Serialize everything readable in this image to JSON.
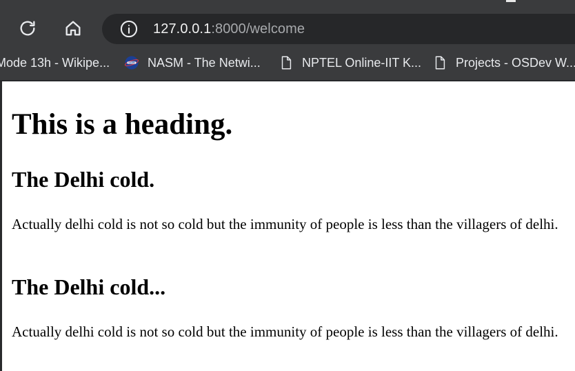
{
  "browser": {
    "url_host": "127.0.0.1",
    "url_rest": ":8000/welcome",
    "bookmarks": [
      {
        "label": "Mode 13h - Wikipe...",
        "icon": "wikipedia-icon"
      },
      {
        "label": "NASM - The Netwi...",
        "icon": "nasm-icon"
      },
      {
        "label": "NPTEL Online-IIT K...",
        "icon": "page-icon"
      },
      {
        "label": "Projects - OSDev W...",
        "icon": "page-icon"
      }
    ]
  },
  "page": {
    "heading": "This is a heading.",
    "sections": [
      {
        "title": "The Delhi cold.",
        "body": "Actually delhi cold is not so cold but the immunity of people is less than the villagers of delhi."
      },
      {
        "title": "The Delhi cold...",
        "body": "Actually delhi cold is not so cold but the immunity of people is less than the villagers of delhi."
      }
    ]
  }
}
